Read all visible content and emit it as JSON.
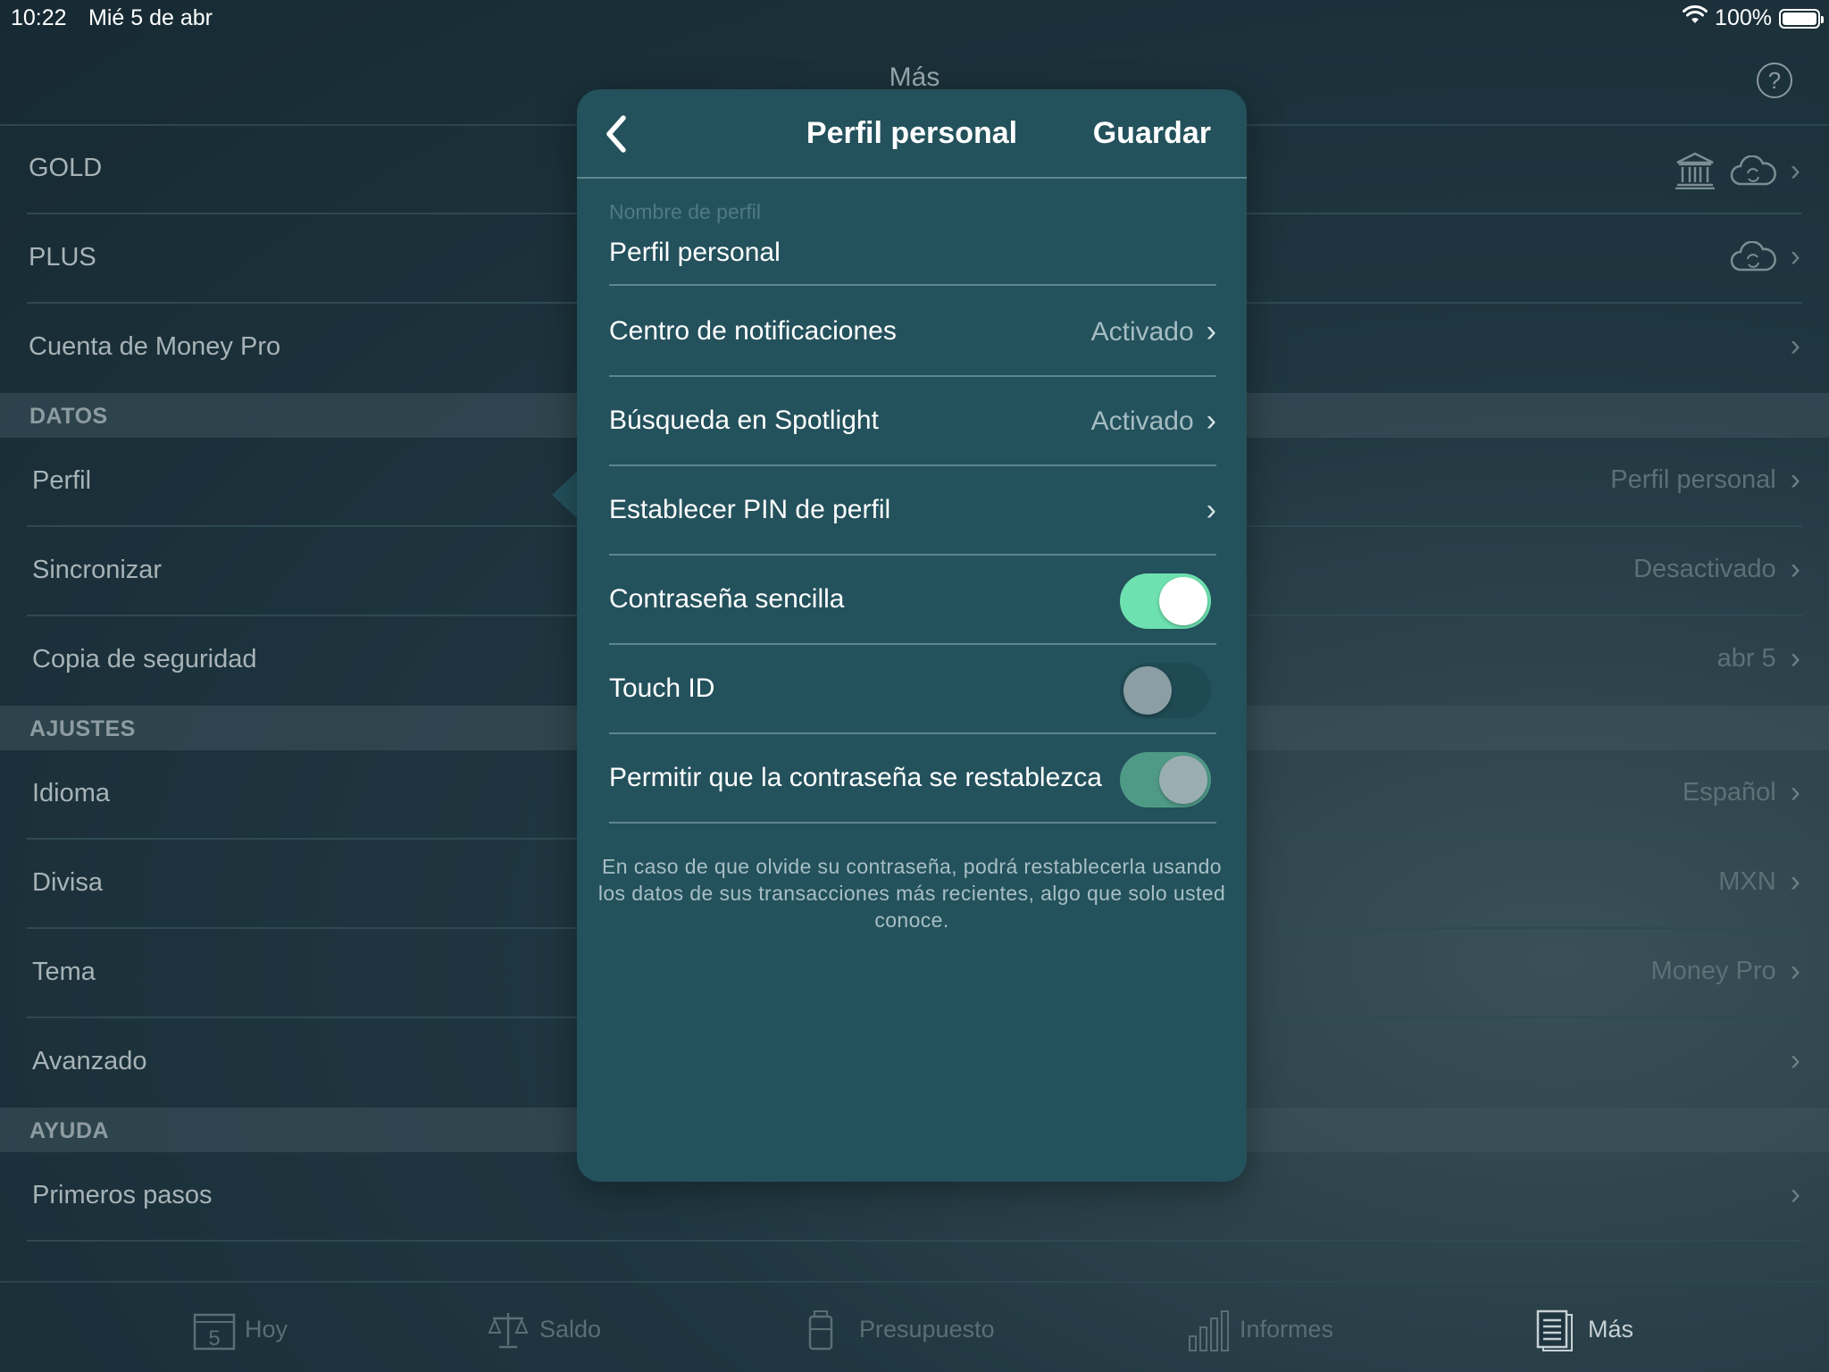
{
  "status_bar": {
    "time": "10:22",
    "date": "Mié 5 de abr",
    "battery": "100%"
  },
  "header": {
    "title": "Más",
    "help_label": "?"
  },
  "background_list": {
    "gold": "GOLD",
    "plus": "PLUS",
    "account": "Cuenta de Money Pro",
    "section_datos": "DATOS",
    "perfil": {
      "label": "Perfil",
      "value": "Perfil personal"
    },
    "sincronizar": {
      "label": "Sincronizar",
      "value": "Desactivado"
    },
    "copia": {
      "label": "Copia de seguridad",
      "value": "abr 5"
    },
    "section_ajustes": "AJUSTES",
    "idioma": {
      "label": "Idioma",
      "value": "Español"
    },
    "divisa": {
      "label": "Divisa",
      "value": "MXN"
    },
    "tema": {
      "label": "Tema",
      "value": "Money Pro"
    },
    "avanzado": {
      "label": "Avanzado"
    },
    "section_ayuda": "AYUDA",
    "primeros": {
      "label": "Primeros pasos"
    }
  },
  "popover": {
    "title": "Perfil personal",
    "save_label": "Guardar",
    "name_field": {
      "label": "Nombre de perfil",
      "value": "Perfil personal"
    },
    "notifications": {
      "label": "Centro de notificaciones",
      "value": "Activado"
    },
    "spotlight": {
      "label": "Búsqueda en Spotlight",
      "value": "Activado"
    },
    "pin": {
      "label": "Establecer PIN de perfil"
    },
    "simple_password": {
      "label": "Contraseña sencilla",
      "state": "on"
    },
    "touch_id": {
      "label": "Touch ID",
      "state": "off"
    },
    "allow_reset": {
      "label": "Permitir que la contraseña se restablezca",
      "state": "on-disabled"
    },
    "footnote": "En caso de que olvide su contraseña, podrá restablecerla usando los datos de sus transacciones más recientes, algo que solo usted conoce."
  },
  "tab_bar": {
    "calendar_day": "5",
    "tabs": [
      "Hoy",
      "Saldo",
      "Presupuesto",
      "Informes",
      "Más"
    ],
    "active": "Más"
  },
  "colors": {
    "toggle_on": "#6ee1b0",
    "popover_bg": "#23515c",
    "background": "#1f3640"
  }
}
